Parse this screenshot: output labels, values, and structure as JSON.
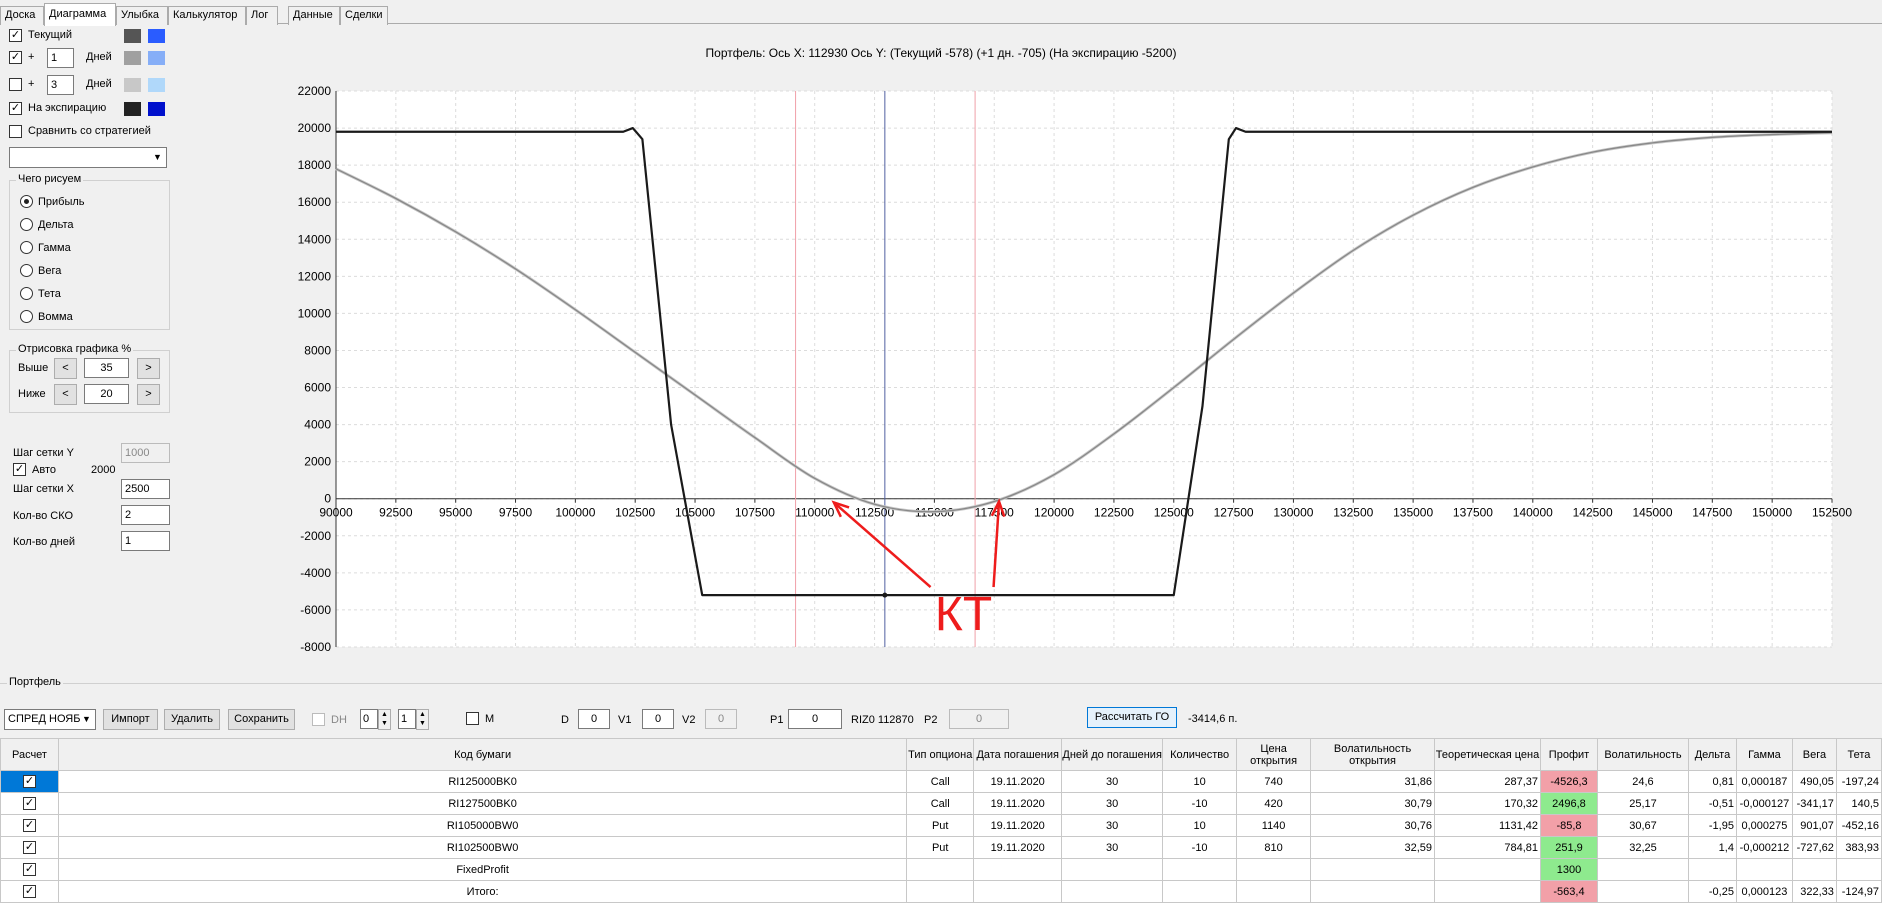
{
  "tabs": [
    "Доска",
    "Диаграмма",
    "Улыбка",
    "Калькулятор",
    "Лог",
    "Данные",
    "Сделки"
  ],
  "active_tab": 1,
  "left_panel": {
    "current_label": "Текущий",
    "plus_label": "+",
    "days_label": "Дней",
    "plus1_value": "1",
    "plus2_value": "3",
    "expiry_label": "На экспирацию",
    "compare_label": "Сравнить со стратегией",
    "what_draw_title": "Чего рисуем",
    "what_draw_options": [
      "Прибыль",
      "Дельта",
      "Гамма",
      "Вега",
      "Тета",
      "Вомма"
    ],
    "drawing_title": "Отрисовка графика %",
    "above_label": "Выше",
    "above_value": "35",
    "below_label": "Ниже",
    "below_value": "20",
    "prev_btn": "<",
    "next_btn": ">",
    "grid_y_label": "Шаг сетки Y",
    "grid_y_value": "1000",
    "auto_label": "Авто",
    "auto_value": "2000",
    "grid_x_label": "Шаг сетки X",
    "grid_x_value": "2500",
    "sko_label": "Кол-во СКО",
    "sko_value": "2",
    "days_count_label": "Кол-во дней",
    "days_count_value": "1"
  },
  "colors": {
    "current": [
      "#555555",
      "#2a5cff"
    ],
    "plus1": [
      "#a0a0a0",
      "#86aef7"
    ],
    "plus2": [
      "#c8c8c8",
      "#b0d8fa"
    ],
    "expiry": [
      "#222222",
      "#0010cc"
    ]
  },
  "chart_title": "Портфель: Ось X: 112930 Ось Y:  (Текущий -578)  (+1 дн. -705)  (На экспирацию -5200)",
  "chart_data": {
    "type": "line",
    "xlim": [
      90000,
      152500
    ],
    "ylim": [
      -8000,
      22000
    ],
    "x_ticks": [
      90000,
      92500,
      95000,
      97500,
      100000,
      102500,
      105000,
      107500,
      110000,
      112500,
      115000,
      117500,
      120000,
      122500,
      125000,
      127500,
      130000,
      132500,
      135000,
      137500,
      140000,
      142500,
      145000,
      147500,
      150000,
      152500
    ],
    "y_ticks": [
      22000,
      20000,
      18000,
      16000,
      14000,
      12000,
      10000,
      8000,
      6000,
      4000,
      2000,
      0,
      -2000,
      -4000,
      -6000,
      -8000
    ],
    "grid": true,
    "cursor_x": 112930,
    "red_lines": [
      109200,
      116700
    ],
    "series": [
      {
        "x": [
          90000,
          92500,
          95000,
          97500,
          100000,
          102500,
          105000,
          107500,
          110000,
          112500,
          115000,
          117500,
          120000,
          122500,
          125000,
          127500,
          130000,
          132500,
          135000,
          137500,
          140000,
          142500,
          145000,
          147500,
          150000,
          152500
        ],
        "values": [
          17800,
          16200,
          14400,
          12400,
          10200,
          7900,
          5600,
          3300,
          1100,
          -300,
          -700,
          -150,
          1300,
          3500,
          6000,
          8600,
          11100,
          13400,
          15300,
          16800,
          17900,
          18700,
          19200,
          19500,
          19650,
          19750
        ],
        "color": "#888888"
      },
      {
        "x": [
          90000,
          102000,
          102400,
          102800,
          104000,
          105300,
          112500,
          125000,
          126200,
          127300,
          127600,
          128000,
          152500
        ],
        "values": [
          19800,
          19800,
          20000,
          19400,
          4000,
          -5200,
          -5200,
          -5200,
          5000,
          19400,
          20000,
          19800,
          19800
        ],
        "color": "#1a1a1a"
      }
    ],
    "annotation": "КТ"
  },
  "portfolio": {
    "title": "Портфель",
    "strategy": "СПРЕД НОЯБ",
    "import_btn": "Импорт",
    "delete_btn": "Удалить",
    "save_btn": "Сохранить",
    "dh_label": "DH",
    "dh1": "0",
    "dh2": "1",
    "m_label": "M",
    "d_label": "D",
    "d_value": "0",
    "v1_label": "V1",
    "v1_value": "0",
    "v2_label": "V2",
    "v2_value": "0",
    "p1_label": "P1",
    "p1_value": "0",
    "riz_label": "RIZ0 112870",
    "p2_label": "P2",
    "p2_value": "0",
    "calc_btn": "Рассчитать ГО",
    "go_value": "-3414,6 п."
  },
  "table": {
    "headers": [
      "Расчет",
      "Код бумаги",
      "Тип опциона",
      "Дата погашения",
      "Дней до погашения",
      "Количество",
      "Цена открытия",
      "Волатильность открытия",
      "Теоретическая цена",
      "Профит",
      "Волатильность",
      "Дельта",
      "Гамма",
      "Вега",
      "Тета"
    ],
    "rows": [
      [
        "RI125000BK0",
        "Call",
        "19.11.2020",
        "30",
        "10",
        "740",
        "31,86",
        "287,37",
        "-4526,3",
        "24,6",
        "0,81",
        "0,000187",
        "490,05",
        "-197,24"
      ],
      [
        "RI127500BK0",
        "Call",
        "19.11.2020",
        "30",
        "-10",
        "420",
        "30,79",
        "170,32",
        "2496,8",
        "25,17",
        "-0,51",
        "-0,000127",
        "-341,17",
        "140,5"
      ],
      [
        "RI105000BW0",
        "Put",
        "19.11.2020",
        "30",
        "10",
        "1140",
        "30,76",
        "1131,42",
        "-85,8",
        "30,67",
        "-1,95",
        "0,000275",
        "901,07",
        "-452,16"
      ],
      [
        "RI102500BW0",
        "Put",
        "19.11.2020",
        "30",
        "-10",
        "810",
        "32,59",
        "784,81",
        "251,9",
        "32,25",
        "1,4",
        "-0,000212",
        "-727,62",
        "383,93"
      ],
      [
        "FixedProfit",
        "",
        "",
        "",
        "",
        "",
        "",
        "",
        "1300",
        "",
        "",
        "",
        "",
        ""
      ],
      [
        "Итого:",
        "",
        "",
        "",
        "",
        "",
        "",
        "",
        "-563,4",
        "",
        "-0,25",
        "0,000123",
        "322,33",
        "-124,97"
      ]
    ],
    "profit_status": [
      "neg",
      "pos",
      "neg",
      "pos",
      "pos",
      "neg"
    ]
  }
}
